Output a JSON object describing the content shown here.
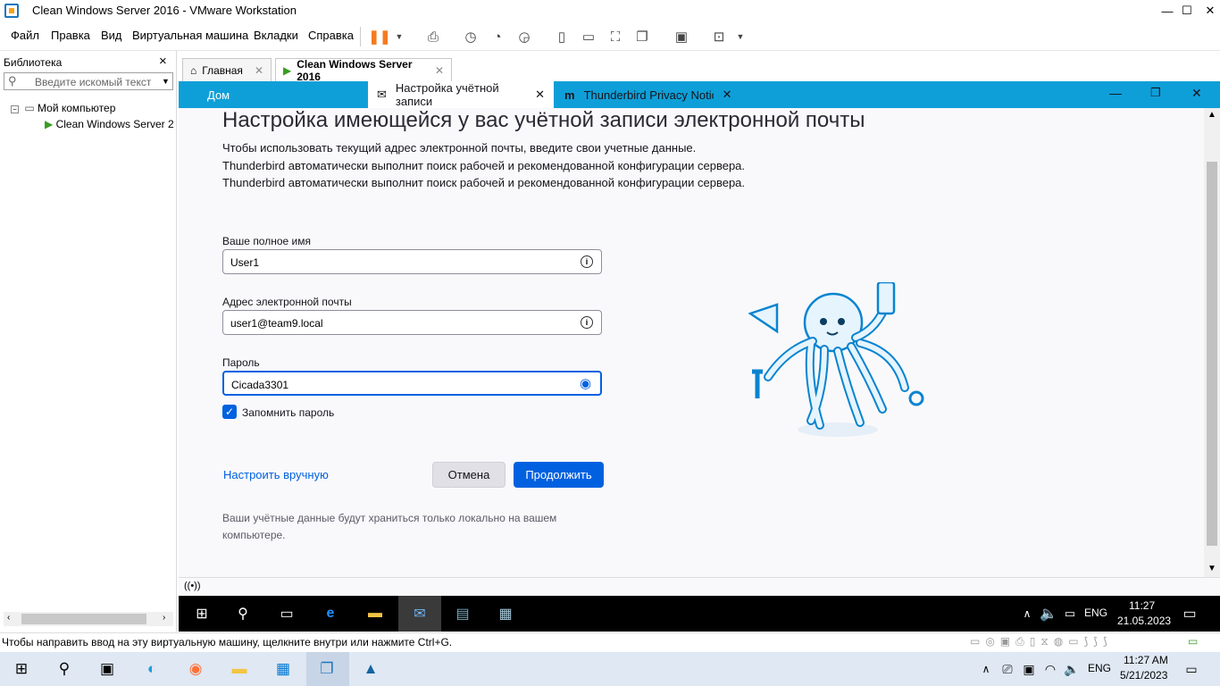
{
  "window": {
    "title": "Clean Windows Server 2016 - VMware Workstation",
    "minimize": "—",
    "maximize": "☐",
    "close": "✕"
  },
  "menu": [
    "Файл",
    "Правка",
    "Вид",
    "Виртуальная машина",
    "Вкладки",
    "Справка"
  ],
  "library": {
    "title": "Библиотека",
    "search_placeholder": "Введите искомый текст",
    "tree_root": "Мой компьютер",
    "tree_child": "Clean Windows Server 2"
  },
  "vm_tabs": [
    {
      "label": "Главная"
    },
    {
      "label": "Clean Windows Server 2016"
    }
  ],
  "firefox_tabs": [
    {
      "label": "Дом"
    },
    {
      "label": "Настройка учётной записи"
    },
    {
      "label": "Thunderbird Privacy Notice"
    }
  ],
  "form": {
    "heading": "Настройка имеющейся у вас учётной записи электронной почты",
    "line1": "Чтобы использовать текущий адрес электронной почты, введите свои учетные данные.",
    "line2": "Thunderbird автоматически выполнит поиск рабочей и рекомендованной конфигурации сервера.",
    "line3": "Thunderbird автоматически выполнит поиск рабочей и рекомендованной конфигурации сервера.",
    "name_label": "Ваше полное имя",
    "name_value": "User1",
    "email_label": "Адрес электронной почты",
    "email_value": "user1@team9.local",
    "password_label": "Пароль",
    "password_value": "Cicada3301",
    "remember_label": "Запомнить пароль",
    "manual_link": "Настроить вручную",
    "cancel": "Отмена",
    "continue": "Продолжить",
    "footer1": "Ваши учётные данные будут храниться только локально на вашем",
    "footer2": "компьютере."
  },
  "guest_tray": {
    "lang": "ENG",
    "time": "11:27",
    "date": "21.05.2023"
  },
  "status_text": "Чтобы направить ввод на эту виртуальную машину, щелкните внутри или нажмите Ctrl+G.",
  "host_tray": {
    "lang": "ENG",
    "time": "11:27 AM",
    "date": "5/21/2023"
  },
  "colors": {
    "accent": "#0061e0",
    "ffbar": "#0f9fd8"
  }
}
